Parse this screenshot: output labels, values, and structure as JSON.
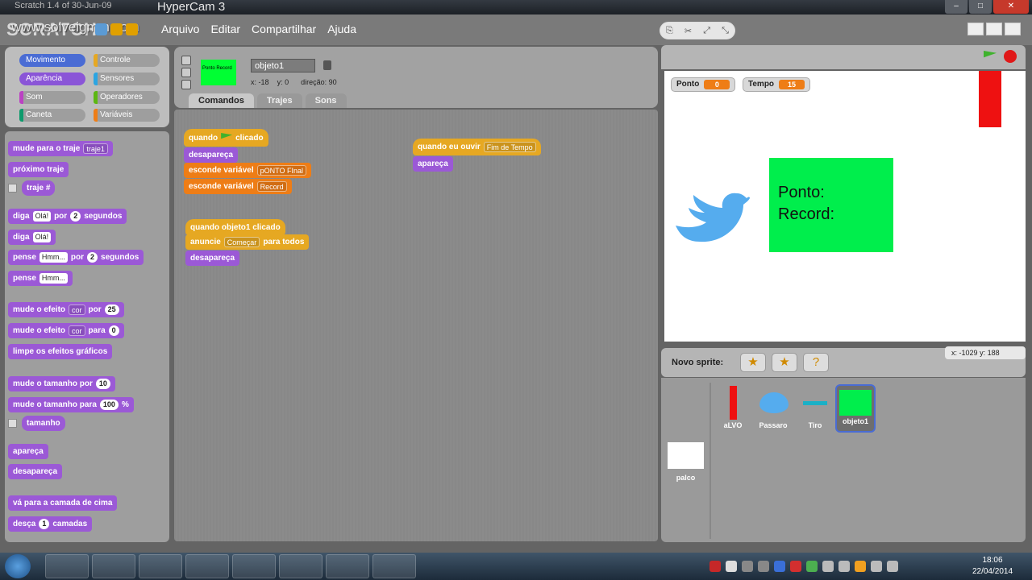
{
  "window": {
    "title": "Scratch 1.4 of 30-Jun-09",
    "recorder": "HyperCam 3",
    "watermark": "www.solveigmm.com"
  },
  "menu": {
    "logo": "SCRATCH",
    "items": [
      "Arquivo",
      "Editar",
      "Compartilhar",
      "Ajuda"
    ]
  },
  "categories": [
    {
      "label": "Movimento",
      "color": "#4a6cd4"
    },
    {
      "label": "Controle",
      "color": "#e6a822"
    },
    {
      "label": "Aparência",
      "color": "#8a55d7"
    },
    {
      "label": "Sensores",
      "color": "#2ca5e2"
    },
    {
      "label": "Som",
      "color": "#bb42c3"
    },
    {
      "label": "Operadores",
      "color": "#5cb712"
    },
    {
      "label": "Caneta",
      "color": "#0e9a6c"
    },
    {
      "label": "Variáveis",
      "color": "#ee7d16"
    }
  ],
  "palette": {
    "b1": "mude para o traje",
    "b1_dd": "traje1",
    "b2": "próximo traje",
    "b3": "traje #",
    "b4a": "diga",
    "b4_in": "Olá!",
    "b4b": "por",
    "b4_num": "2",
    "b4c": "segundos",
    "b5a": "diga",
    "b5_in": "Olá!",
    "b6a": "pense",
    "b6_in": "Hmm...",
    "b6b": "por",
    "b6_num": "2",
    "b6c": "segundos",
    "b7a": "pense",
    "b7_in": "Hmm...",
    "b8a": "mude o efeito",
    "b8_dd": "cor",
    "b8b": "por",
    "b8_num": "25",
    "b9a": "mude o efeito",
    "b9_dd": "cor",
    "b9b": "para",
    "b9_num": "0",
    "b10": "limpe os efeitos gráficos",
    "b11a": "mude o tamanho por",
    "b11_num": "10",
    "b12a": "mude o tamanho para",
    "b12_num": "100",
    "b12b": "%",
    "b13": "tamanho",
    "b14": "apareça",
    "b15": "desapareça",
    "b16": "vá para a camada de cima",
    "b17a": "desça",
    "b17_num": "1",
    "b17b": "camadas"
  },
  "sprite": {
    "name": "objeto1",
    "thumb_text": "Ponto Record",
    "x_label": "x:",
    "x": "-18",
    "y_label": "y:",
    "y": "0",
    "dir_label": "direção:",
    "dir": "90"
  },
  "tabs": [
    "Comandos",
    "Trajes",
    "Sons"
  ],
  "scripts": {
    "s1_hat_a": "quando",
    "s1_hat_b": "clicado",
    "s1_b1": "desapareça",
    "s1_b2": "esconde variável",
    "s1_b2_dd": "pONTO FInal",
    "s1_b3": "esconde variável",
    "s1_b3_dd": "Record",
    "s2_hat": "quando objeto1 clicado",
    "s2_b1a": "anuncie",
    "s2_b1_dd": "Começar",
    "s2_b1b": "para todos",
    "s2_b2": "desapareça",
    "s3_hat": "quando eu ouvir",
    "s3_hat_dd": "Fim de Tempo",
    "s3_b1": "apareça"
  },
  "stage": {
    "var1_label": "Ponto",
    "var1_val": "0",
    "var2_label": "Tempo",
    "var2_val": "15",
    "box_line1": "Ponto:",
    "box_line2": "Record:",
    "mouse_x_label": "x:",
    "mouse_x": "-1029",
    "mouse_y_label": "y:",
    "mouse_y": "188"
  },
  "sprites": {
    "new_label": "Novo sprite:",
    "stage_label": "palco",
    "list": [
      {
        "name": "aLVO"
      },
      {
        "name": "Passaro"
      },
      {
        "name": "Tiro"
      },
      {
        "name": "objeto1"
      }
    ]
  },
  "taskbar": {
    "time": "18:06",
    "date": "22/04/2014"
  }
}
